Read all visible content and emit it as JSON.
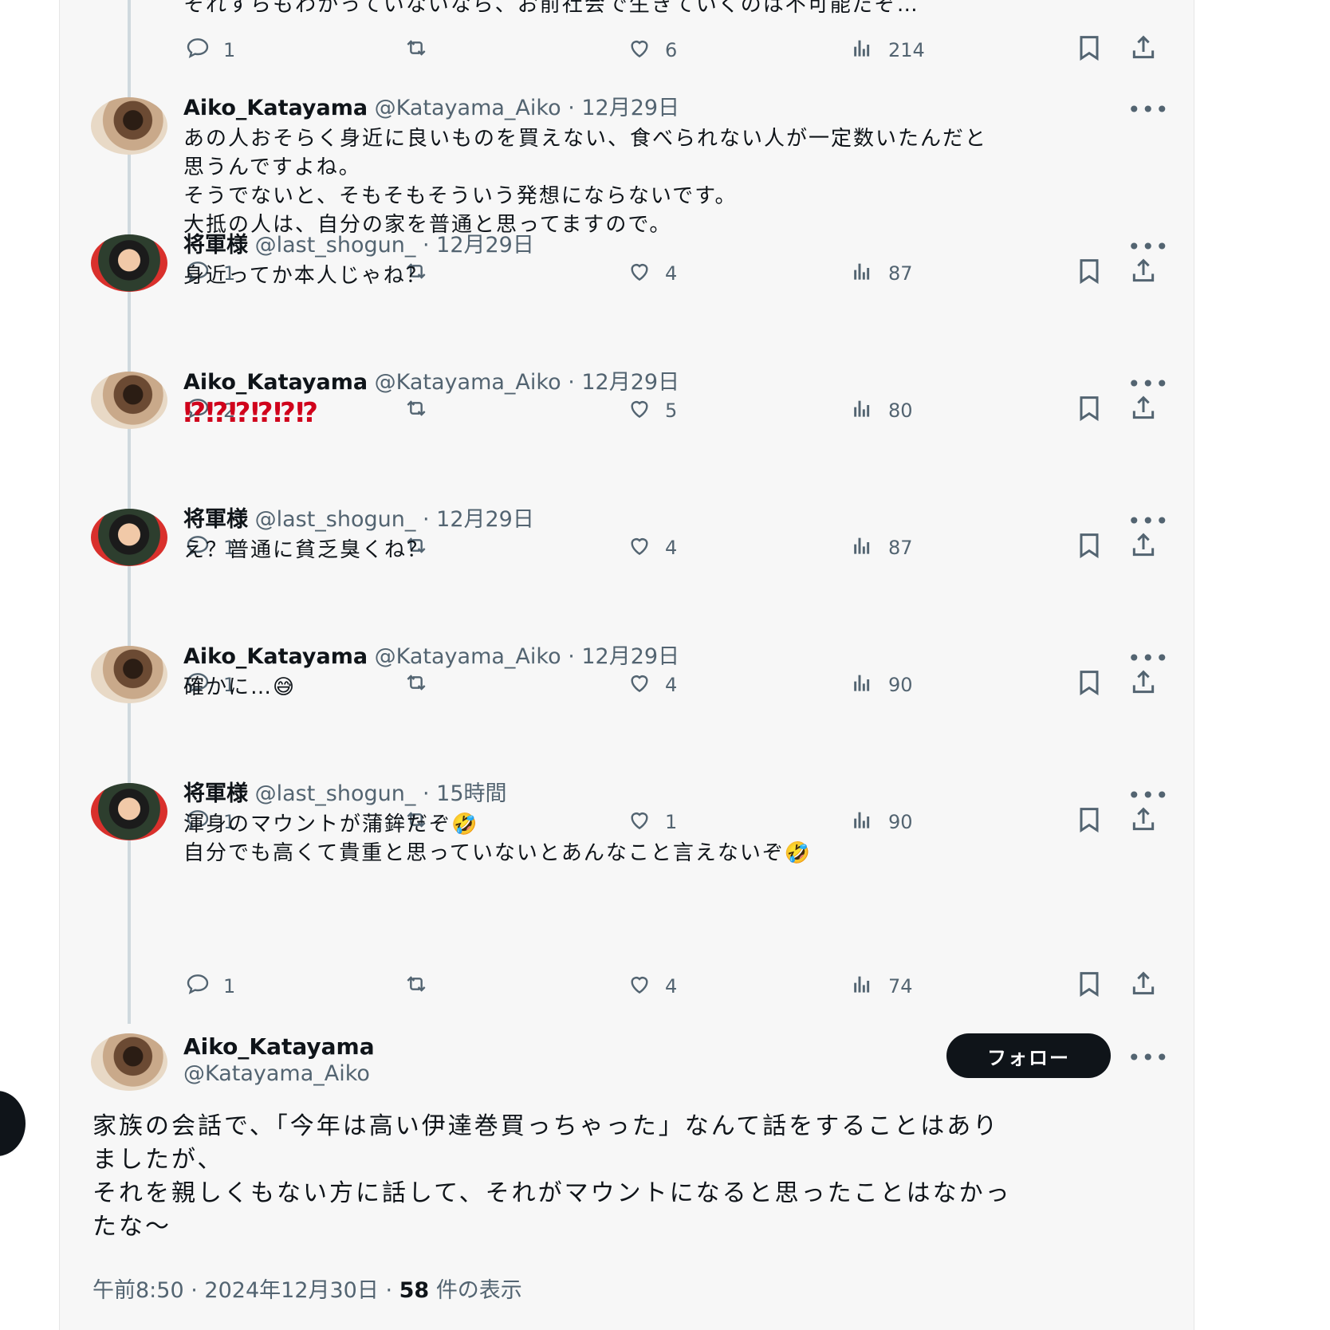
{
  "thread": [
    {
      "kind": "partial",
      "text": "それすらもわかっていないなら、お前社会で生きていくのは不可能だぞ…",
      "replies": "1",
      "likes": "6",
      "views": "214"
    },
    {
      "author": "Aiko_Katayama",
      "handle": "@Katayama_Aiko",
      "time": "12月29日",
      "avatar": "aiko-avatar",
      "lines": [
        "あの人おそらく身近に良いものを買えない、食べられない人が一定数いたんだと",
        "思うんですよね。",
        "そうでないと、そもそもそういう発想にならないです。",
        "大抵の人は、自分の家を普通と思ってますので。"
      ],
      "replies": "1",
      "likes": "4",
      "views": "87"
    },
    {
      "author": "将軍様",
      "handle": "@last_shogun_",
      "time": "12月29日",
      "avatar": "shogun-avatar",
      "lines": [
        "身近ってか本人じゃね？"
      ],
      "replies": "2",
      "likes": "5",
      "views": "80"
    },
    {
      "author": "Aiko_Katayama",
      "handle": "@Katayama_Aiko",
      "time": "12月29日",
      "avatar": "aiko-avatar",
      "lines": [
        "⁉⁉⁉⁉⁉⁉"
      ],
      "replies": "1",
      "likes": "4",
      "views": "87"
    },
    {
      "author": "将軍様",
      "handle": "@last_shogun_",
      "time": "12月29日",
      "avatar": "shogun-avatar",
      "lines": [
        "え？普通に貧乏臭くね？"
      ],
      "replies": "1",
      "likes": "4",
      "views": "90"
    },
    {
      "author": "Aiko_Katayama",
      "handle": "@Katayama_Aiko",
      "time": "12月29日",
      "avatar": "aiko-avatar",
      "lines": [
        "確かに…😅"
      ],
      "replies": "1",
      "likes": "1",
      "views": "90"
    },
    {
      "author": "将軍様",
      "handle": "@last_shogun_",
      "time": "15時間",
      "avatar": "shogun-avatar",
      "lines": [
        "渾身のマウントが蒲鉾だぞ🤣",
        "自分でも高くて貴重と思っていないとあんなこと言えないぞ🤣"
      ],
      "replies": "1",
      "likes": "4",
      "views": "74"
    }
  ],
  "separator": "·",
  "main_post": {
    "author": "Aiko_Katayama",
    "handle": "@Katayama_Aiko",
    "follow_label": "フォロー",
    "lines": [
      "家族の会話で、「今年は高い伊達巻買っちゃった」なんて話をすることはあり",
      "ましたが、",
      "それを親しくもない方に話して、それがマウントになると思ったことはなかっ",
      "たな〜"
    ],
    "time": "午前8:50",
    "date": "2024年12月30日",
    "views_count": "58",
    "views_label": "件の表示"
  },
  "icons": {
    "reply": "reply-icon",
    "retweet": "retweet-icon",
    "like": "heart-icon",
    "views": "views-icon",
    "bookmark": "bookmark-icon",
    "share": "share-icon",
    "more": "more-icon"
  },
  "colors": {
    "text": "#0f1419",
    "muted": "#536471",
    "accent_red": "#d0021b",
    "button": "#0f1419"
  }
}
